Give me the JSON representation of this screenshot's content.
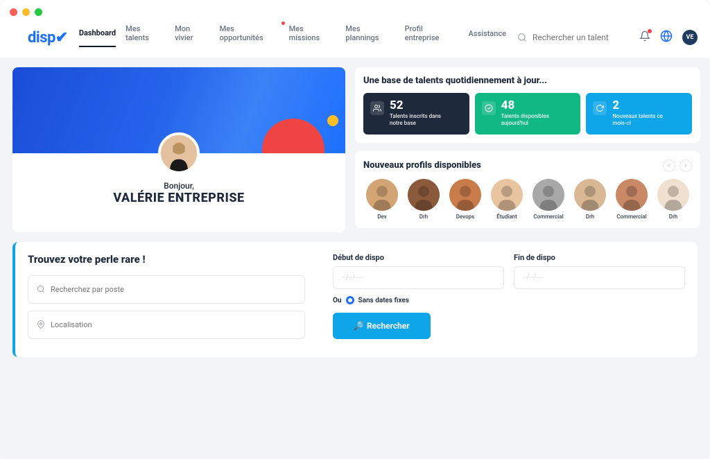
{
  "logo": "dispo",
  "nav": {
    "items": [
      {
        "label": "Dashboard",
        "active": true,
        "dot": false
      },
      {
        "label": "Mes talents",
        "active": false,
        "dot": false
      },
      {
        "label": "Mon vivier",
        "active": false,
        "dot": false
      },
      {
        "label": "Mes opportunités",
        "active": false,
        "dot": true
      },
      {
        "label": "Mes missions",
        "active": false,
        "dot": false
      },
      {
        "label": "Mes plannings",
        "active": false,
        "dot": false
      },
      {
        "label": "Profil entreprise",
        "active": false,
        "dot": false
      },
      {
        "label": "Assistance",
        "active": false,
        "dot": false
      }
    ]
  },
  "header_search_placeholder": "Rechercher un talent",
  "avatar_initials": "VE",
  "welcome": {
    "greeting": "Bonjour,",
    "name": "VALÉRIE ENTREPRISE"
  },
  "stats": {
    "title": "Une base de talents quotidiennement à jour...",
    "boxes": [
      {
        "value": "52",
        "label": "Talents inscrits dans notre base"
      },
      {
        "value": "48",
        "label": "Talents disponibles aujourd'hui"
      },
      {
        "value": "2",
        "label": "Nouveaux talents ce mois-ci"
      }
    ]
  },
  "profiles": {
    "title": "Nouveaux profils disponibles",
    "items": [
      {
        "role": "Dev",
        "bg": "#d4a574"
      },
      {
        "role": "Drh",
        "bg": "#8b5a3c"
      },
      {
        "role": "Devops",
        "bg": "#c97b4a"
      },
      {
        "role": "Étudiant",
        "bg": "#e8c4a0"
      },
      {
        "role": "Commercial",
        "bg": "#a8a8a8"
      },
      {
        "role": "Drh",
        "bg": "#d9b896"
      },
      {
        "role": "Commercial",
        "bg": "#c98866"
      },
      {
        "role": "Drh",
        "bg": "#f0e0d0"
      }
    ]
  },
  "search": {
    "title": "Trouvez votre perle rare !",
    "post_placeholder": "Recherchez par poste",
    "location_placeholder": "Localisation",
    "start_label": "Début de dispo",
    "end_label": "Fin de dispo",
    "date_placeholder": "--/--/----",
    "or_label": "Ou",
    "no_dates_label": "Sans dates fixes",
    "button": "Rechercher"
  }
}
